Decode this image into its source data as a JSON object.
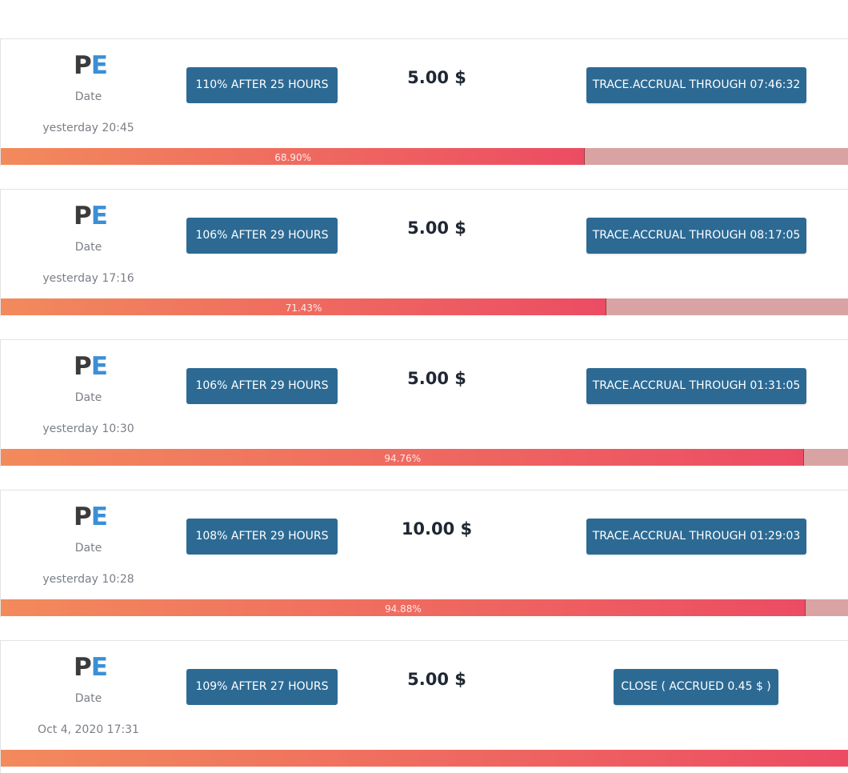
{
  "deposits": [
    {
      "logo": {
        "p": "P",
        "e": "E"
      },
      "date_label": "Date",
      "date_value": "yesterday 20:45",
      "plan": "110% AFTER 25 HOURS",
      "amount": "5.00 $",
      "action": "TRACE.ACCRUAL THROUGH 07:46:32",
      "progress": 68.9,
      "progress_label": "68.90%"
    },
    {
      "logo": {
        "p": "P",
        "e": "E"
      },
      "date_label": "Date",
      "date_value": "yesterday 17:16",
      "plan": "106% AFTER 29 HOURS",
      "amount": "5.00 $",
      "action": "TRACE.ACCRUAL THROUGH 08:17:05",
      "progress": 71.43,
      "progress_label": "71.43%"
    },
    {
      "logo": {
        "p": "P",
        "e": "E"
      },
      "date_label": "Date",
      "date_value": "yesterday 10:30",
      "plan": "106% AFTER 29 HOURS",
      "amount": "5.00 $",
      "action": "TRACE.ACCRUAL THROUGH 01:31:05",
      "progress": 94.76,
      "progress_label": "94.76%"
    },
    {
      "logo": {
        "p": "P",
        "e": "E"
      },
      "date_label": "Date",
      "date_value": "yesterday 10:28",
      "plan": "108% AFTER 29 HOURS",
      "amount": "10.00 $",
      "action": "TRACE.ACCRUAL THROUGH 01:29:03",
      "progress": 94.88,
      "progress_label": "94.88%"
    },
    {
      "logo": {
        "p": "P",
        "e": "E"
      },
      "date_label": "Date",
      "date_value": "Oct 4, 2020 17:31",
      "plan": "109% AFTER 27 HOURS",
      "amount": "5.00 $",
      "action": "CLOSE ( ACCRUED 0.45 $ )",
      "progress": 100,
      "progress_label": ""
    }
  ],
  "colors": {
    "button": "#2c6a94",
    "logo_p": "#3b3b3b",
    "logo_e": "#3b8fd6",
    "progress_start": "#f28a5c",
    "progress_end": "#ec4c63",
    "progress_track": "#d9a3a3"
  }
}
